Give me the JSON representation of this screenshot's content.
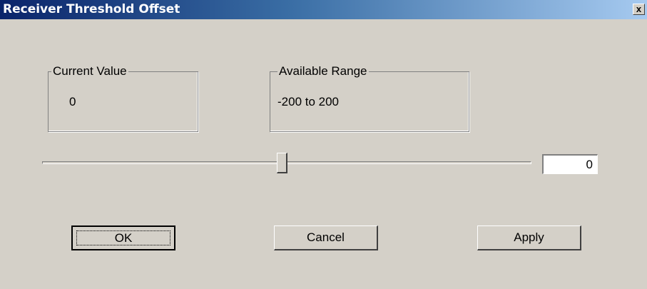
{
  "window": {
    "title": "Receiver Threshold Offset",
    "close_label": "x"
  },
  "current_value": {
    "label": "Current Value",
    "value": "0"
  },
  "available_range": {
    "label": "Available Range",
    "value": "-200 to 200",
    "min": -200,
    "max": 200
  },
  "slider": {
    "value": 0
  },
  "value_field": {
    "value": "0"
  },
  "buttons": {
    "ok": "OK",
    "cancel": "Cancel",
    "apply": "Apply"
  }
}
